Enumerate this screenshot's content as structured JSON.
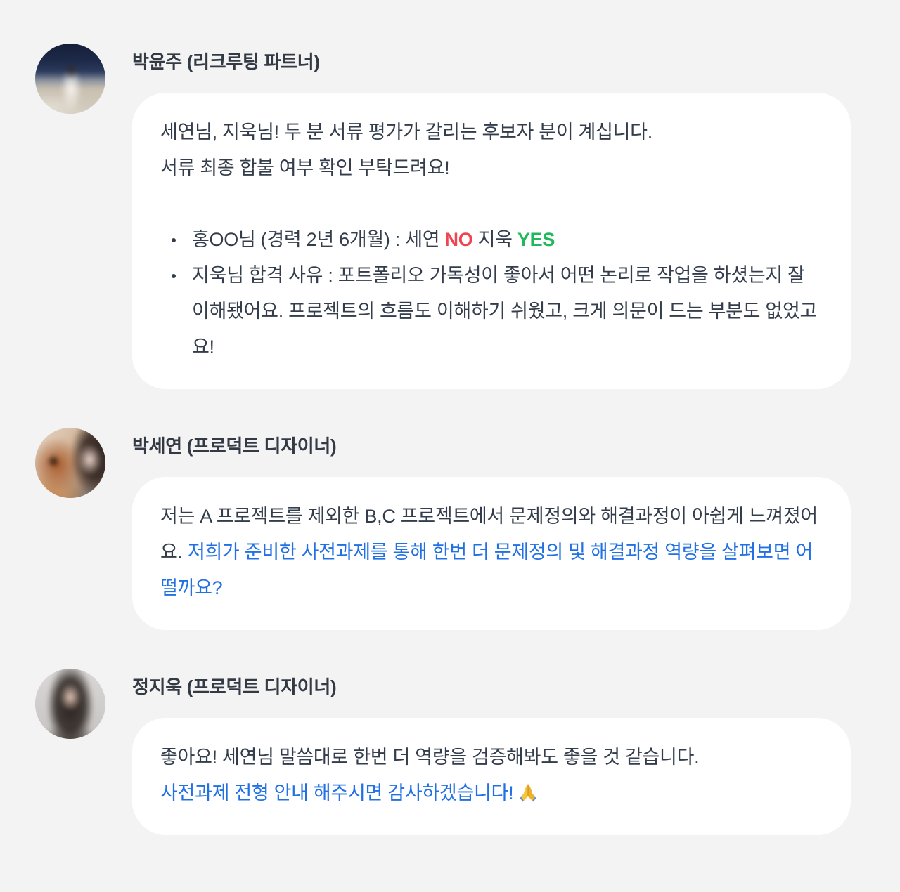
{
  "colors": {
    "background": "#f3f3f4",
    "bubble": "#ffffff",
    "text": "#333d4b",
    "highlight_blue": "#2170e4",
    "vote_no_red": "#f04452",
    "vote_yes_green": "#1fb85a"
  },
  "messages": [
    {
      "author": "박윤주 (리크루팅 파트너)",
      "avatar_icon": "profile-photo",
      "lines": [
        "세연님, 지욱님! 두 분 서류 평가가 갈리는 후보자 분이 계십니다.",
        "서류 최종 합불 여부 확인 부탁드려요!"
      ],
      "bullets": [
        {
          "candidate": "홍OO님 (경력 2년 6개월) : 세연",
          "vote_a": "NO",
          "voter_b": "지욱",
          "vote_b": "YES"
        },
        {
          "text": "지욱님 합격 사유 : 포트폴리오 가독성이 좋아서 어떤 논리로 작업을 하셨는지 잘 이해됐어요. 프로젝트의 흐름도 이해하기 쉬웠고, 크게 의문이 드는 부분도 없었고요!"
        }
      ]
    },
    {
      "author": "박세연 (프로덕트 디자이너)",
      "avatar_icon": "profile-photo",
      "text": "저는 A 프로젝트를 제외한 B,C 프로젝트에서 문제정의와 해결과정이 아쉽게 느껴졌어요.",
      "highlight": "저희가 준비한 사전과제를 통해 한번 더 문제정의 및 해결과정 역량을 살펴보면 어떨까요?"
    },
    {
      "author": "정지욱 (프로덕트 디자이너)",
      "avatar_icon": "profile-photo",
      "text": "좋아요! 세연님 말씀대로 한번 더 역량을 검증해봐도 좋을 것 같습니다.",
      "highlight": "사전과제 전형 안내 해주시면 감사하겠습니다!",
      "highlight_icon": "praying-hands-icon"
    }
  ]
}
